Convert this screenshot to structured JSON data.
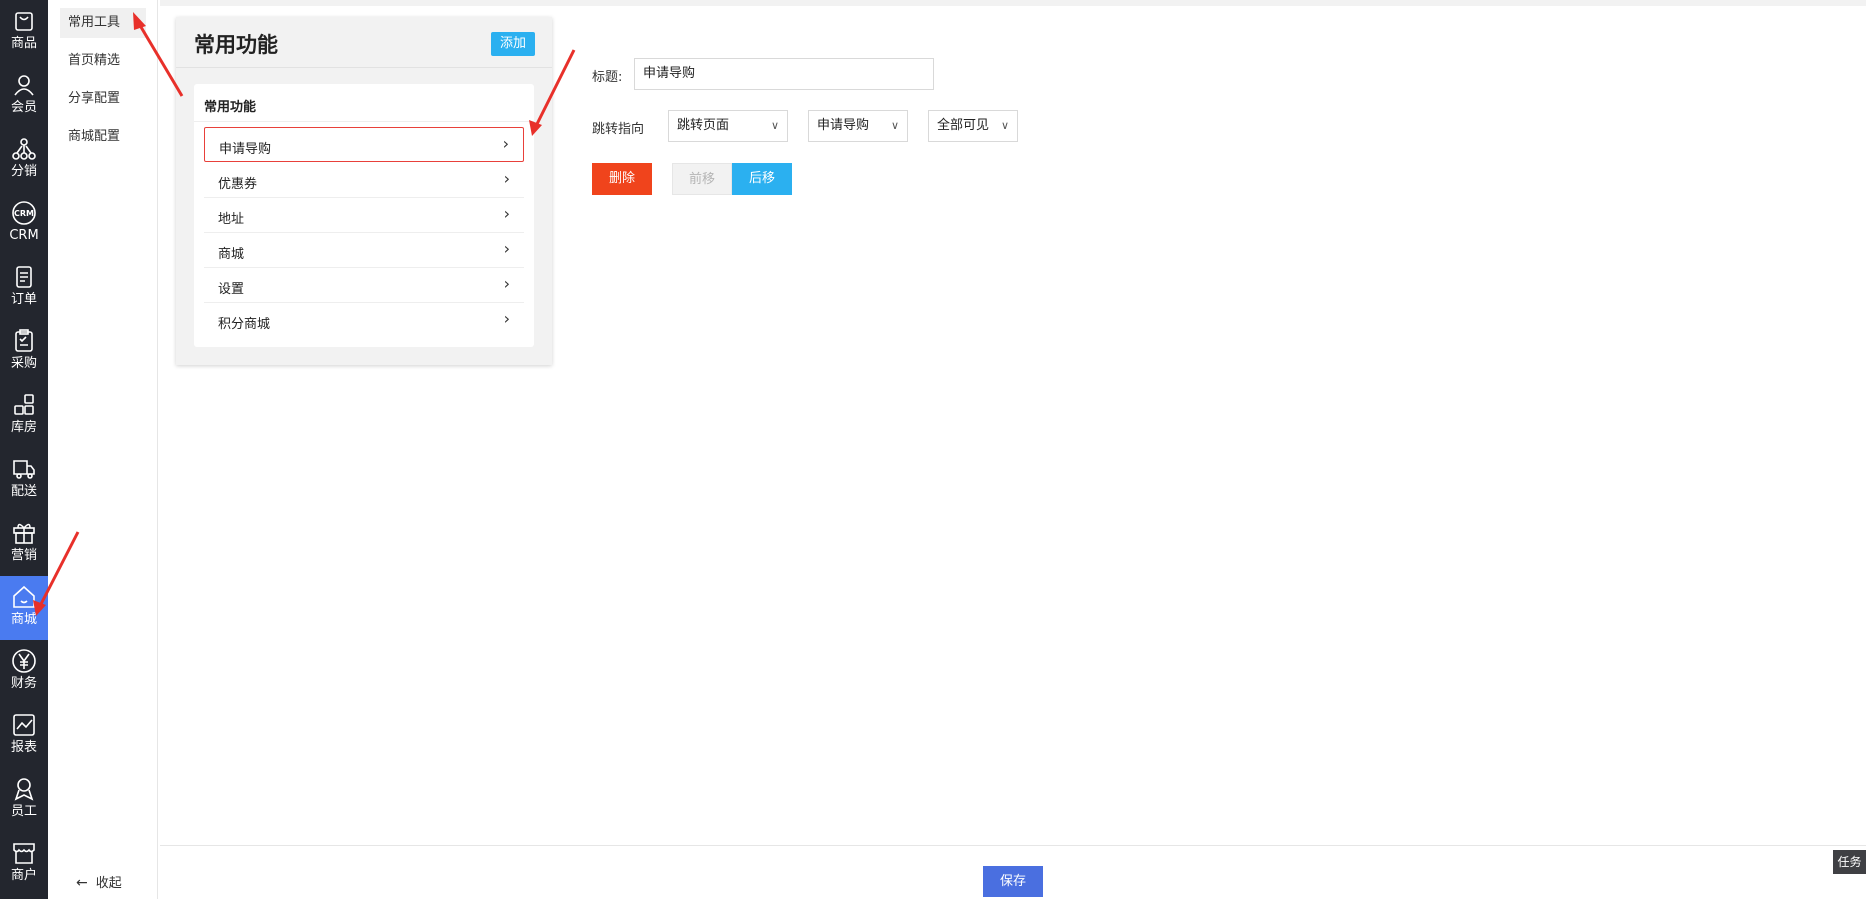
{
  "rail": {
    "items": [
      {
        "label": "商品",
        "icon": "bag-icon"
      },
      {
        "label": "会员",
        "icon": "user-icon"
      },
      {
        "label": "分销",
        "icon": "network-icon"
      },
      {
        "label": "CRM",
        "icon": "crm-icon"
      },
      {
        "label": "订单",
        "icon": "document-icon"
      },
      {
        "label": "采购",
        "icon": "clipboard-icon"
      },
      {
        "label": "库房",
        "icon": "grid-icon"
      },
      {
        "label": "配送",
        "icon": "truck-icon"
      },
      {
        "label": "营销",
        "icon": "gift-icon"
      },
      {
        "label": "商城",
        "icon": "home-icon",
        "active": true
      },
      {
        "label": "财务",
        "icon": "yen-icon"
      },
      {
        "label": "报表",
        "icon": "chart-icon"
      },
      {
        "label": "员工",
        "icon": "badge-icon"
      },
      {
        "label": "商户",
        "icon": "store-icon"
      }
    ],
    "active_color": "#4a7bf0"
  },
  "submenu": {
    "items": [
      "常用工具",
      "首页精选",
      "分享配置",
      "商城配置"
    ],
    "active": "常用工具",
    "collapse_label": "收起"
  },
  "card": {
    "title": "常用功能",
    "add_label": "添加",
    "panel_title": "常用功能",
    "functions": [
      "申请导购",
      "优惠券",
      "地址",
      "商城",
      "设置",
      "积分商城"
    ],
    "selected": "申请导购"
  },
  "form": {
    "title_label": "标题:",
    "title_value": "申请导购",
    "jump_label": "跳转指向",
    "jump_type": "跳转页面",
    "jump_target": "申请导购",
    "visibility": "全部可见",
    "delete_label": "删除",
    "prev_label": "前移",
    "next_label": "后移"
  },
  "footer": {
    "save_label": "保存",
    "task_label": "任务"
  },
  "colors": {
    "accent_blue": "#2bb0f0",
    "danger": "#f0441c",
    "save": "#4a6fe0",
    "annotation_red": "#e8302a"
  }
}
